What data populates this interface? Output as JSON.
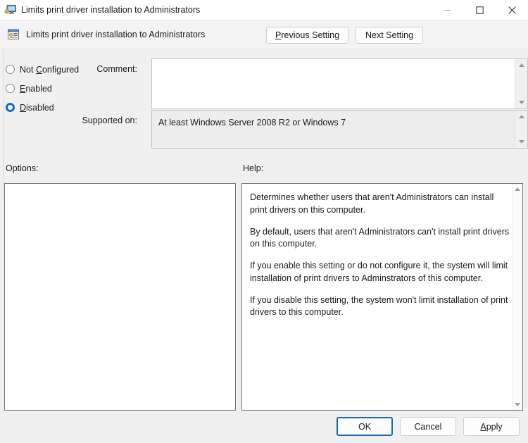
{
  "window": {
    "title": "Limits print driver installation to Administrators",
    "icon": "policy-monitor-icon",
    "controls": {
      "minimize": "minimize-icon",
      "maximize": "maximize-icon",
      "close": "close-icon"
    }
  },
  "header": {
    "title": "Limits print driver installation to Administrators",
    "icon": "policy-setting-icon",
    "previous_label_accel": "P",
    "previous_label_rest": "revious Setting",
    "next_label": "Next Setting"
  },
  "state": {
    "options": [
      {
        "label_accel": "",
        "label_pre": "Not ",
        "label_mid": "C",
        "label_rest": "onfigured",
        "checked": false,
        "name": "not-configured"
      },
      {
        "label_accel": "",
        "label_pre": "",
        "label_mid": "E",
        "label_rest": "nabled",
        "checked": false,
        "name": "enabled"
      },
      {
        "label_accel": "",
        "label_pre": "",
        "label_mid": "D",
        "label_rest": "isabled",
        "checked": true,
        "name": "disabled"
      }
    ]
  },
  "comment": {
    "label": "Comment:",
    "value": "",
    "placeholder": ""
  },
  "supported_on": {
    "label": "Supported on:",
    "value": "At least Windows Server 2008 R2 or Windows 7"
  },
  "options_pane": {
    "caption": "Options:",
    "value": ""
  },
  "help_pane": {
    "caption": "Help:",
    "paragraphs": [
      "Determines whether users that aren't Administrators can install print drivers on this computer.",
      "By default, users that aren't Administrators can't install print drivers on this computer.",
      "If you enable this setting or do not configure it, the system will limit installation of print drivers to Adminstrators of this computer.",
      "If you disable this setting, the system won't limit installation of print drivers to this computer."
    ]
  },
  "footer": {
    "ok_label": "OK",
    "cancel_label": "Cancel",
    "apply_accel": "A",
    "apply_rest": "pply"
  },
  "colors": {
    "accent": "#0a6cc4",
    "default_button_border": "#0f6cbd",
    "window_background": "#f0f0f0",
    "pane_background": "#ffffff"
  }
}
